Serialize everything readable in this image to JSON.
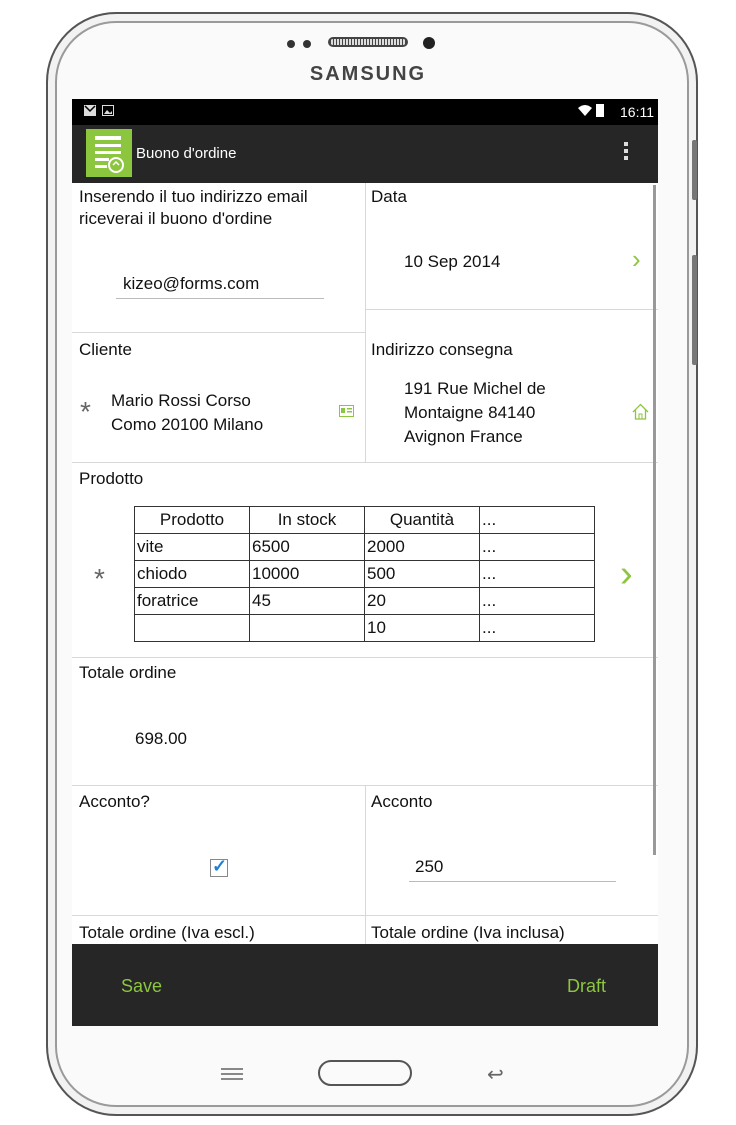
{
  "device": {
    "brand": "SAMSUNG"
  },
  "statusbar": {
    "time": "16:11",
    "icons": [
      "gmail-icon",
      "image-icon",
      "wifi-icon",
      "battery-icon"
    ]
  },
  "actionbar": {
    "title": "Buono d'ordine",
    "icon": "form-icon"
  },
  "form": {
    "email": {
      "label": "Inserendo il tuo indirizzo email riceverai il buono d'ordine",
      "value": "kizeo@forms.com"
    },
    "date": {
      "label": "Data",
      "value": "10 Sep 2014"
    },
    "client": {
      "label": "Cliente",
      "value_line1": "Mario Rossi Corso",
      "value_line2": "Como 20100 Milano",
      "required": "*"
    },
    "address": {
      "label": "Indirizzo consegna",
      "line1": "191 Rue Michel de",
      "line2": "Montaigne 84140",
      "line3": "Avignon France"
    },
    "product": {
      "label": "Prodotto",
      "required": "*",
      "headers": [
        "Prodotto",
        "In stock",
        "Quantità",
        "..."
      ],
      "rows": [
        [
          "vite",
          "6500",
          "2000",
          "..."
        ],
        [
          "chiodo",
          "10000",
          "500",
          "..."
        ],
        [
          "foratrice",
          "45",
          "20",
          "..."
        ],
        [
          "",
          "",
          "10",
          "..."
        ]
      ]
    },
    "total": {
      "label": "Totale ordine",
      "value": "698.00"
    },
    "deposit_question": {
      "label": "Acconto?",
      "checked": true
    },
    "deposit": {
      "label": "Acconto",
      "value": "250"
    },
    "total_excl": {
      "label": "Totale ordine (Iva escl.)"
    },
    "total_incl": {
      "label": "Totale ordine (Iva inclusa)"
    }
  },
  "bottombar": {
    "save": "Save",
    "draft": "Draft"
  },
  "colors": {
    "accent": "#8cc63f",
    "bar": "#262626",
    "checkbox": "#1f7fd6"
  }
}
